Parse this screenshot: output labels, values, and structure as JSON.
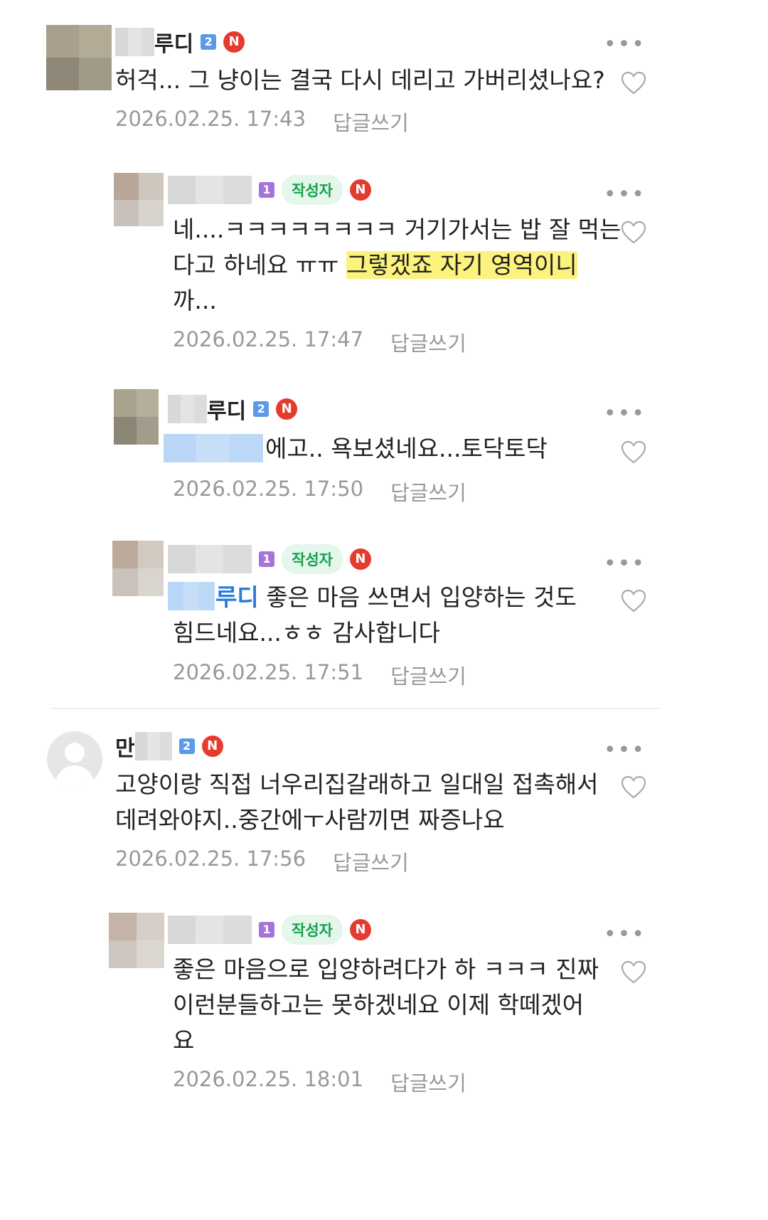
{
  "comments": [
    {
      "author": "루디",
      "level": "2",
      "time": "2026.02.25. 17:43",
      "reply": "답글쓰기",
      "text": "허걱... 그 냥이는 결국 다시 데리고 가버리셨나요?"
    },
    {
      "badge": "작성자",
      "level": "1",
      "time": "2026.02.25. 17:47",
      "reply": "답글쓰기",
      "line1": "네....ㅋㅋㅋㅋㅋㅋㅋㅋ 거기가서는 밥 잘 먹는",
      "line2a": "다고 하네요 ㅠㅠ ",
      "line2b": "그렇겠죠 자기 영역이니",
      "line3": "까..."
    },
    {
      "author": "루디",
      "level": "2",
      "time": "2026.02.25. 17:50",
      "reply": "답글쓰기",
      "text": "에고.. 욕보셨네요...토닥토닥"
    },
    {
      "badge": "작성자",
      "level": "1",
      "time": "2026.02.25. 17:51",
      "reply": "답글쓰기",
      "mention": "루디",
      "line1": " 좋은 마음 쓰면서 입양하는 것도",
      "line2": "힘드네요...ㅎㅎ 감사합니다"
    },
    {
      "author": "만",
      "level": "2",
      "time": "2026.02.25. 17:56",
      "reply": "답글쓰기",
      "line1": "고양이랑 직접 너우리집갈래하고 일대일 접촉해서",
      "line2": "데려와야지..중간에ㅜ사람끼면 짜증나요"
    },
    {
      "badge": "작성자",
      "level": "1",
      "time": "2026.02.25. 18:01",
      "reply": "답글쓰기",
      "line1": "좋은 마음으로 입양하려다가 하 ㅋㅋㅋ 진짜",
      "line2": "이런분들하고는 못하겠네요 이제 학떼겠어",
      "line3": "요"
    }
  ],
  "icons": {
    "more": "more-icon",
    "heart": "heart-icon",
    "n": "N"
  }
}
